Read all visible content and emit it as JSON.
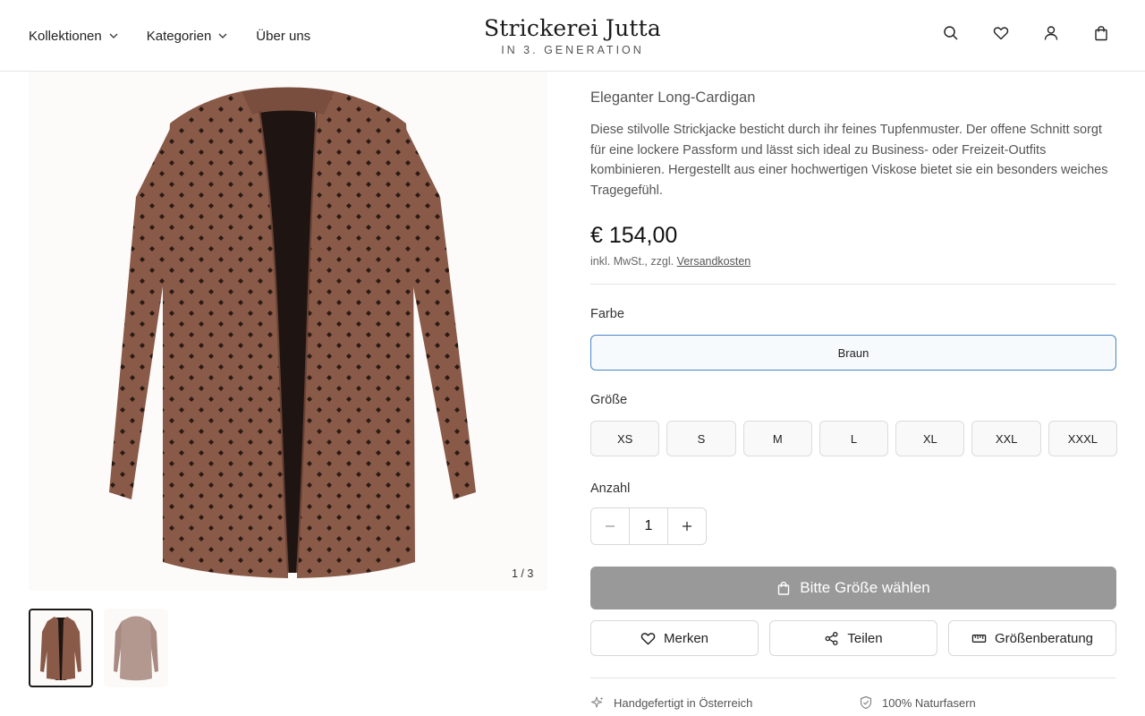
{
  "header": {
    "nav": [
      {
        "label": "Kollektionen",
        "dropdown": true
      },
      {
        "label": "Kategorien",
        "dropdown": true
      },
      {
        "label": "Über uns",
        "dropdown": false
      }
    ],
    "logo_title": "Strickerei Jutta",
    "logo_subtitle": "IN 3. GENERATION",
    "icons": [
      "search-icon",
      "heart-icon",
      "user-icon",
      "bag-icon"
    ]
  },
  "gallery": {
    "counter": "1 / 3",
    "thumbnails": [
      "front-view",
      "back-view"
    ]
  },
  "product": {
    "subtitle": "Eleganter Long-Cardigan",
    "description": "Diese stilvolle Strickjacke besticht durch ihr feines Tupfenmuster. Der offene Schnitt sorgt für eine lockere Passform und lässt sich ideal zu Business- oder Freizeit-Outfits kombinieren. Hergestellt aus einer hochwertigen Viskose bietet sie ein besonders weiches Tragegefühl.",
    "price": "€ 154,00",
    "tax_prefix": "inkl. MwSt., zzgl.",
    "tax_link": "Versandkosten",
    "color_label": "Farbe",
    "color_value": "Braun",
    "size_label": "Größe",
    "sizes": [
      "XS",
      "S",
      "M",
      "L",
      "XL",
      "XXL",
      "XXXL"
    ],
    "quantity_label": "Anzahl",
    "quantity": "1",
    "cta_label": "Bitte Größe wählen",
    "actions": {
      "save": "Merken",
      "share": "Teilen",
      "size_advice": "Größenberatung"
    },
    "features": [
      "Handgefertigt in Österreich",
      "100% Naturfasern"
    ]
  },
  "colors": {
    "cardigan": "#8a5a48",
    "dots": "#2a1a14",
    "cta_bg": "#999999",
    "selected_border": "#4a86c5"
  }
}
